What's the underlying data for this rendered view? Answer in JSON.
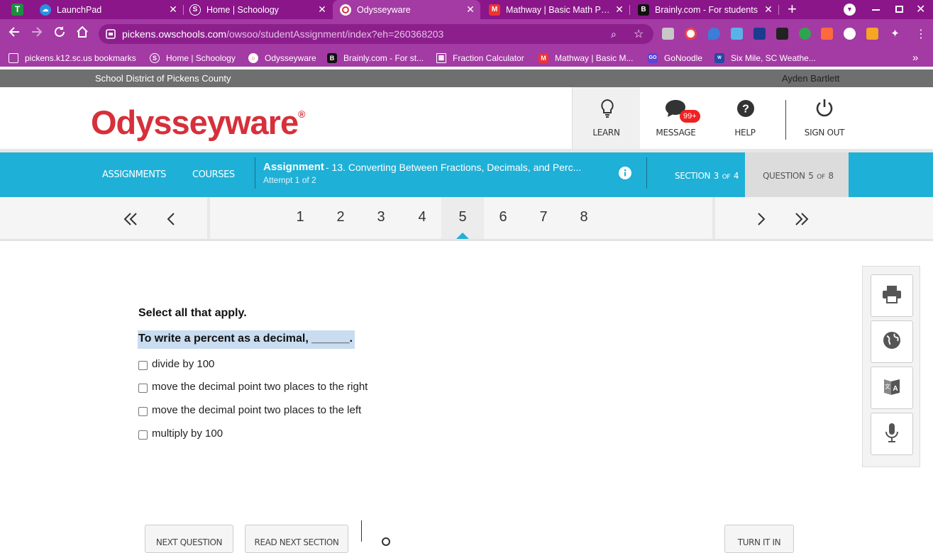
{
  "browser": {
    "tabs": [
      {
        "title": "LaunchPad",
        "icon": "launchpad-icon"
      },
      {
        "title": "Home | Schoology",
        "icon": "schoology-icon"
      },
      {
        "title": "Odysseyware",
        "icon": "odysseyware-icon",
        "active": true
      },
      {
        "title": "Mathway | Basic Math Prob",
        "icon": "mathway-icon"
      },
      {
        "title": "Brainly.com - For students",
        "icon": "brainly-icon"
      }
    ],
    "url_host": "pickens.owschools.com",
    "url_path": "/owsoo/studentAssignment/index?eh=260368203",
    "bookmarks": [
      {
        "label": "pickens.k12.sc.us bookmarks",
        "icon": "folder-icon"
      },
      {
        "label": "Home | Schoology",
        "icon": "schoology-icon"
      },
      {
        "label": "Odysseyware",
        "icon": "odysseyware-icon"
      },
      {
        "label": "Brainly.com - For st...",
        "icon": "brainly-icon"
      },
      {
        "label": "Fraction Calculator",
        "icon": "calculator-icon"
      },
      {
        "label": "Mathway | Basic M...",
        "icon": "mathway-icon"
      },
      {
        "label": "GoNoodle",
        "icon": "gonoodle-icon"
      },
      {
        "label": "Six Mile, SC Weathe...",
        "icon": "weather-icon"
      }
    ],
    "bookmarks_overflow": "»"
  },
  "site": {
    "district": "School District of Pickens County",
    "user": "Ayden Bartlett",
    "logo": "Odysseyware",
    "logo_mark": "®",
    "nav": {
      "learn": "LEARN",
      "message": "MESSAGE",
      "message_badge": "99+",
      "help": "HELP",
      "signout": "SIGN OUT"
    },
    "bar": {
      "assignments": "ASSIGNMENTS",
      "courses": "COURSES",
      "assignment_label": "Assignment",
      "assignment_title": "- 13. Converting Between Fractions, Decimals, and Perc...",
      "attempt": "Attempt 1 of 2",
      "section_prefix": "SECTION",
      "section_num": "3",
      "section_of": "OF",
      "section_total": "4",
      "question_prefix": "QUESTION",
      "question_num": "5",
      "question_of": "OF",
      "question_total": "8"
    },
    "question_numbers": [
      "1",
      "2",
      "3",
      "4",
      "5",
      "6",
      "7",
      "8"
    ],
    "current_question": "5"
  },
  "question": {
    "instruction": "Select all that apply.",
    "prompt": "To write a percent as a decimal, ______.",
    "options": [
      "divide by 100",
      "move the decimal point two places to the right",
      "move the decimal point two places to the left",
      "multiply by 100"
    ]
  },
  "footer": {
    "next_question": "NEXT QUESTION",
    "read_next": "READ NEXT SECTION",
    "turn_in": "TURN IT IN"
  },
  "colors": {
    "chrome": "#a43aa4",
    "brand": "#d6303b",
    "bar": "#1fb0d7",
    "highlight": "#c9dcf0"
  }
}
